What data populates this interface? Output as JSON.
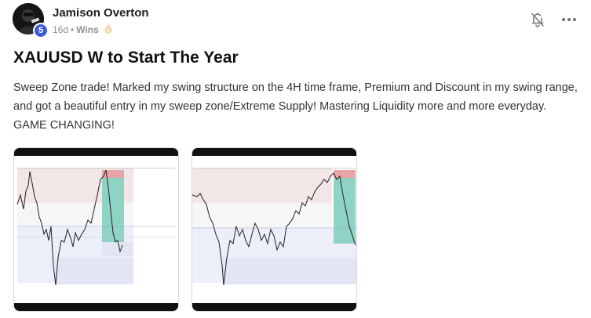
{
  "author": {
    "name": "Jamison Overton",
    "level": "5",
    "avatar_icon": "profile-photo"
  },
  "post_meta": {
    "time": "16d",
    "separator": "•",
    "category": "Wins",
    "category_icon": "flame-icon"
  },
  "actions": {
    "notify_icon": "bell-off-icon",
    "more_icon": "more-horizontal-icon"
  },
  "post": {
    "title": "XAUUSD W to Start The Year",
    "body": "Sweep Zone trade! Marked my swing structure on the 4H time frame, Premium and Discount in my swing range, and got a beautiful entry in my sweep zone/Extreme Supply! Mastering Liquidity more and more everyday. GAME CHANGING!"
  },
  "attachments": [
    {
      "kind": "chart-screenshot",
      "icon": "candlestick-chart-image"
    },
    {
      "kind": "chart-screenshot",
      "icon": "candlestick-chart-image"
    }
  ],
  "colors": {
    "level_badge": "#3e5bd6",
    "premium_zone": "#f3e6e6",
    "discount_zone": "#eceef9",
    "stop_zone": "#e8a3a8",
    "target_zone": "#8fd3c4"
  }
}
